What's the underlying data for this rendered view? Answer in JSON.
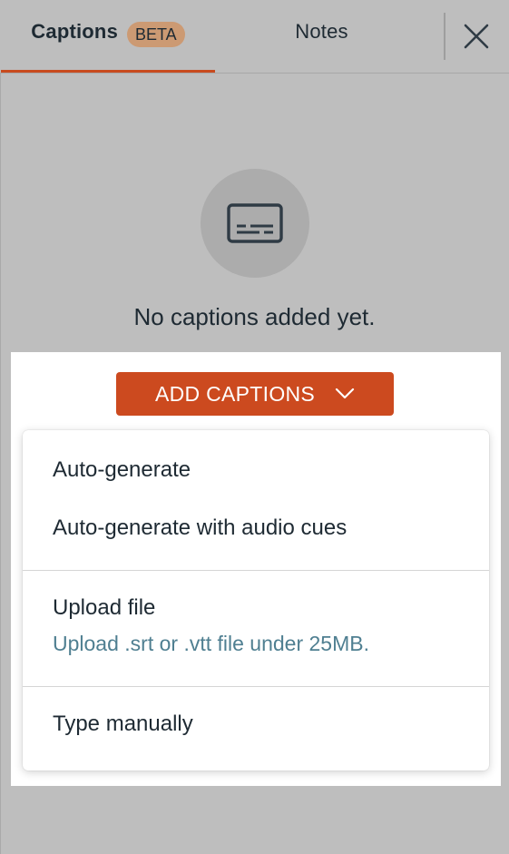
{
  "tabs": [
    {
      "label": "Captions",
      "badge": "BETA",
      "active": true
    },
    {
      "label": "Notes",
      "active": false
    }
  ],
  "empty_state": {
    "icon": "subtitles-icon",
    "message": "No captions added yet."
  },
  "add_button": {
    "label": "ADD CAPTIONS",
    "icon": "chevron-down-icon"
  },
  "menu": {
    "auto_generate": "Auto-generate",
    "auto_generate_audio": "Auto-generate with audio cues",
    "upload_file": "Upload file",
    "upload_file_hint": "Upload .srt or .vtt file under 25MB.",
    "type_manually": "Type manually"
  },
  "colors": {
    "accent": "#cc4a1f",
    "badge": "#cc9a73",
    "hint_text": "#4f7f91"
  }
}
